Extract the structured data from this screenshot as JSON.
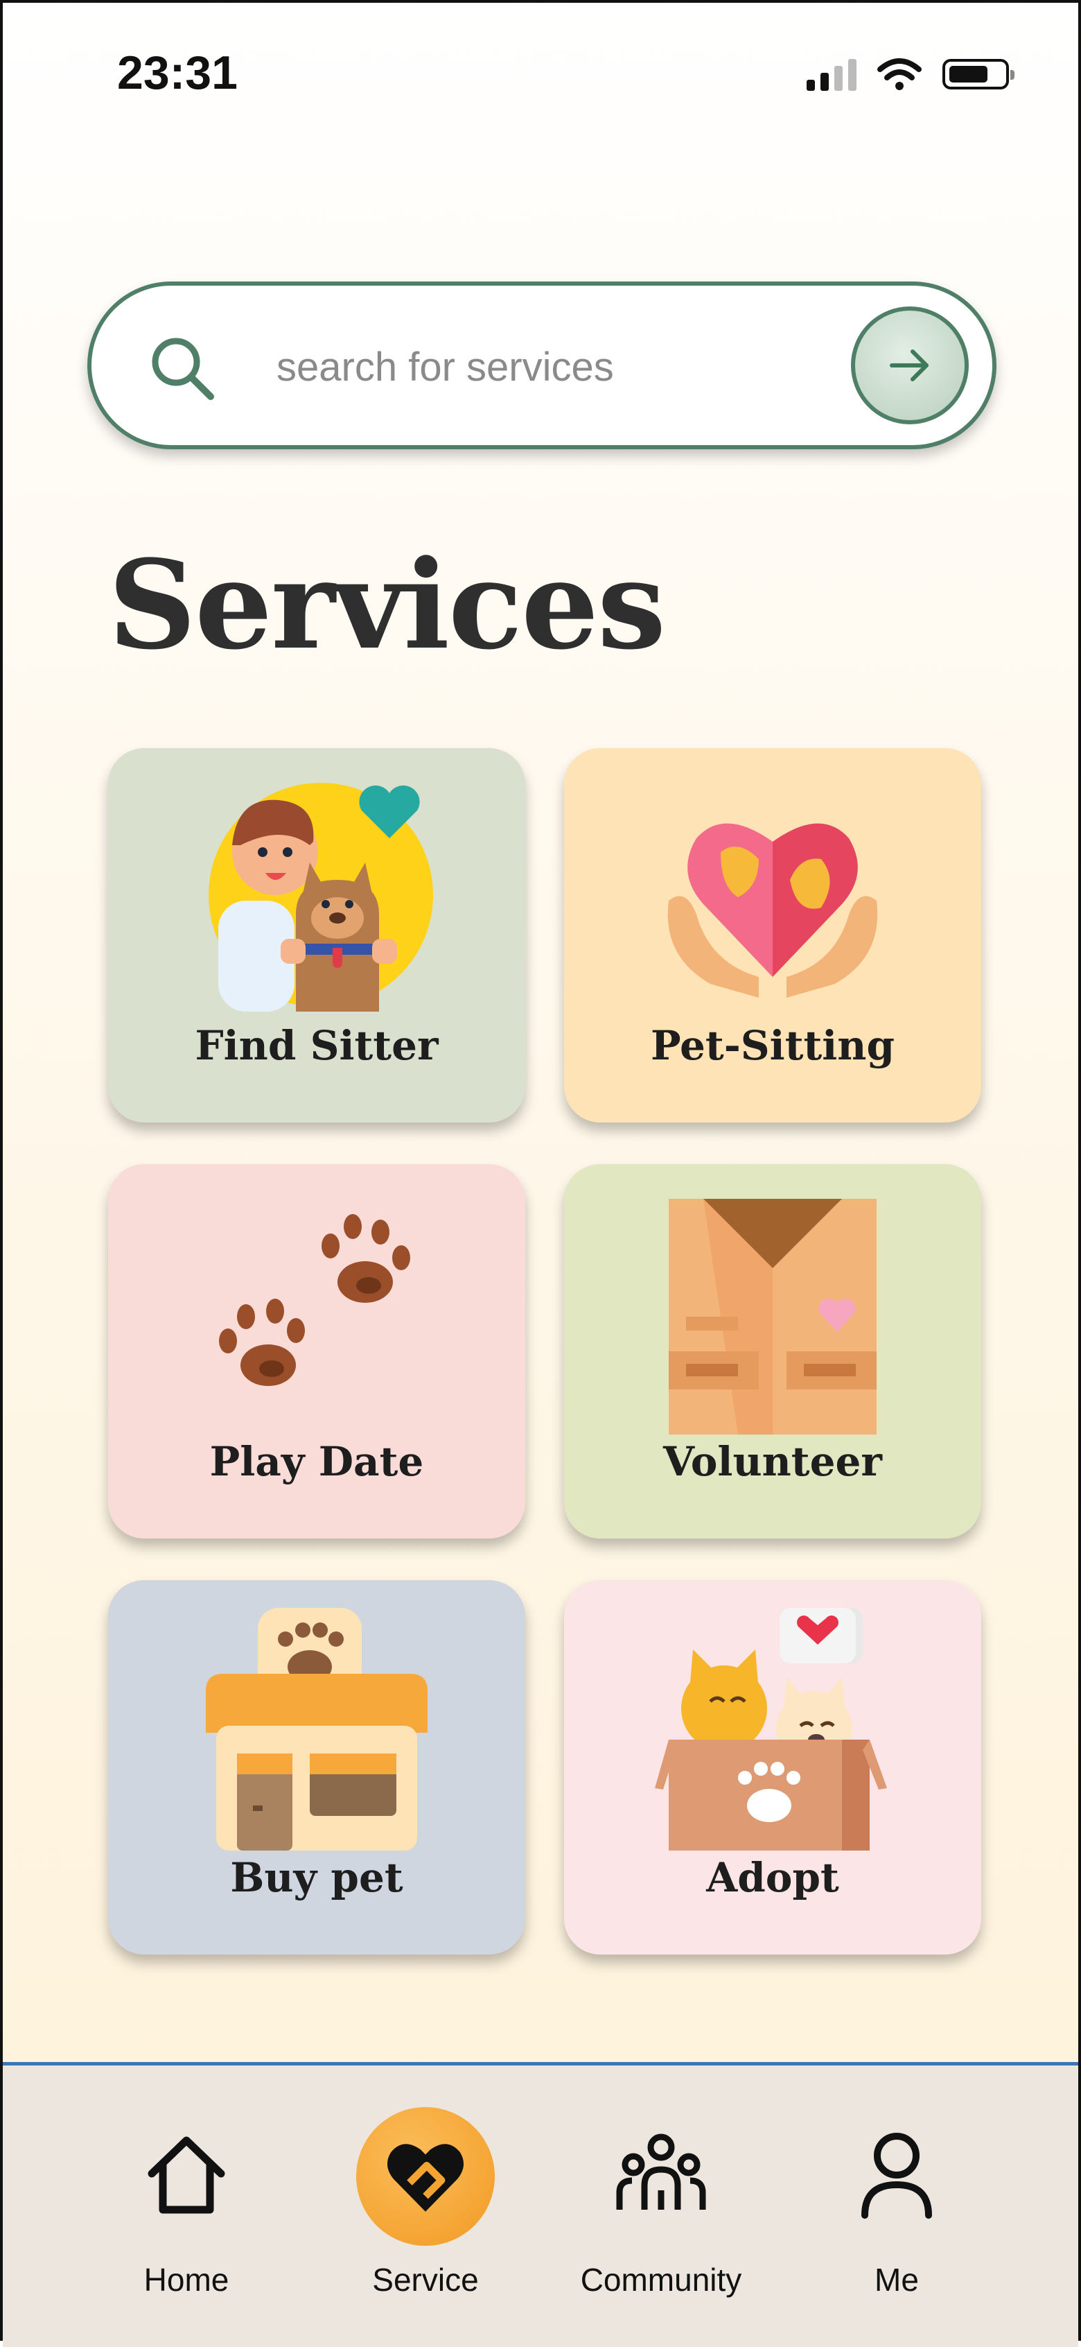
{
  "status_bar": {
    "time": "23:31"
  },
  "search": {
    "placeholder": "search for services"
  },
  "page": {
    "title": "Services"
  },
  "cards": [
    {
      "label": "Find Sitter",
      "bg": "#d9e0ce"
    },
    {
      "label": "Pet-Sitting",
      "bg": "#fde3b5"
    },
    {
      "label": "Play Date",
      "bg": "#f9dcd8"
    },
    {
      "label": "Volunteer",
      "bg": "#e1e7c0"
    },
    {
      "label": "Buy pet",
      "bg": "#cfd6df"
    },
    {
      "label": "Adopt",
      "bg": "#fbe5e6"
    }
  ],
  "nav": {
    "items": [
      {
        "label": "Home",
        "icon": "home-icon"
      },
      {
        "label": "Service",
        "icon": "service-heart-icon",
        "active": true
      },
      {
        "label": "Community",
        "icon": "community-icon"
      },
      {
        "label": "Me",
        "icon": "person-icon"
      }
    ],
    "active_color": "#f4a531"
  },
  "colors": {
    "accent_green": "#4f7f66",
    "nav_bg": "#ece6df"
  }
}
